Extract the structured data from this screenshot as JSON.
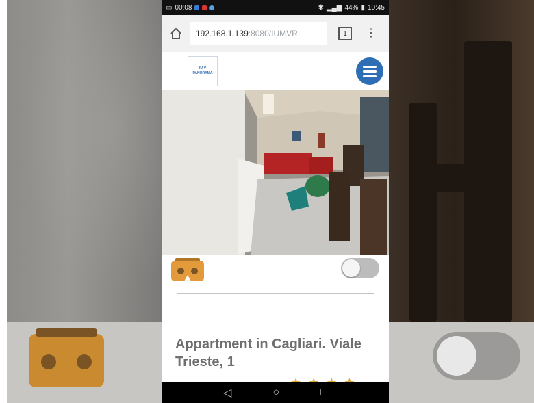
{
  "status_bar": {
    "time_left": "00:08",
    "battery": "44%",
    "time_right": "10:45"
  },
  "browser": {
    "url_host": "192.168.1.139",
    "url_rest": ":8080/IUMVR",
    "tab_count": "1"
  },
  "site": {
    "logo_line1": "IU-V",
    "logo_line2": "PANORAMA"
  },
  "listing": {
    "title": "Appartment in Cagliari. Viale Trieste, 1",
    "rating": 4
  },
  "vr_toggle": {
    "on": false
  },
  "colors": {
    "brand_blue": "#2e6eb5",
    "vr_orange": "#e39a3a",
    "star": "#e0a93a"
  },
  "icons": {
    "home": "home-icon",
    "tabs": "tab-count-icon",
    "overflow": "more-vert-icon",
    "menu": "hamburger-icon",
    "vr": "cardboard-vr-icon",
    "back": "back-triangle-icon",
    "home_nav": "home-circle-icon",
    "recents": "recents-square-icon"
  }
}
